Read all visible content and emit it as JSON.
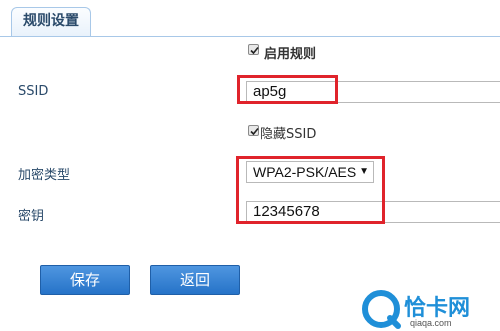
{
  "tab": {
    "label": "规则设置"
  },
  "enable_rule": {
    "label": "启用规则",
    "checked": true
  },
  "ssid": {
    "label": "SSID",
    "value": "ap5g"
  },
  "hide_ssid": {
    "label": "隐藏SSID",
    "checked": true
  },
  "encryption": {
    "label": "加密类型",
    "value": "WPA2-PSK/AES",
    "arrow": "▼"
  },
  "key": {
    "label": "密钥",
    "value": "12345678"
  },
  "buttons": {
    "save": "保存",
    "back": "返回"
  },
  "watermark": {
    "brand": "恰卡网",
    "url": "qiaqa.com"
  },
  "colors": {
    "highlight": "#e0232b",
    "button": "#2f7ed0",
    "label": "#2a4a6a"
  }
}
